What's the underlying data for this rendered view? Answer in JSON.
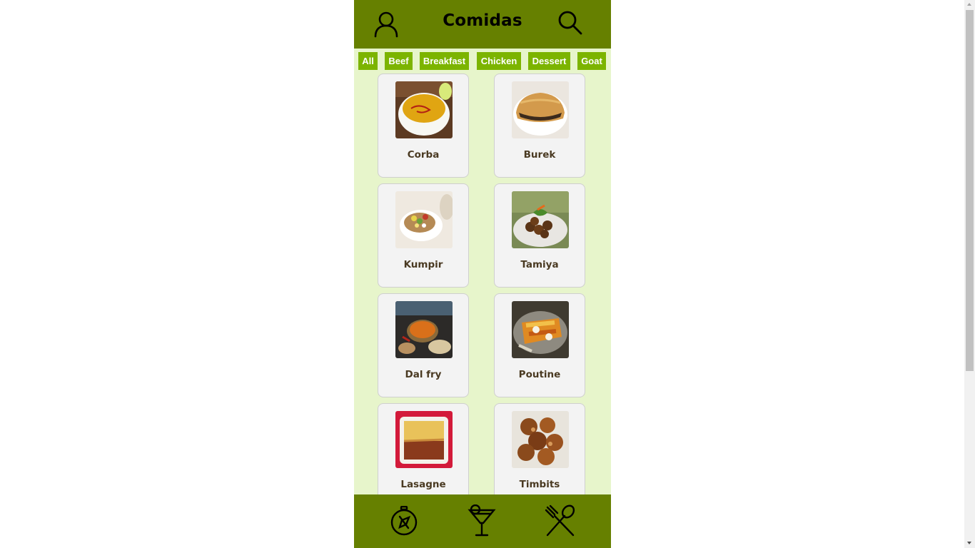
{
  "header": {
    "title": "Comidas",
    "profile_icon": "profile-icon",
    "search_icon": "search-icon"
  },
  "filters": [
    "All",
    "Beef",
    "Breakfast",
    "Chicken",
    "Dessert",
    "Goat"
  ],
  "recipes": [
    {
      "name": "Corba"
    },
    {
      "name": "Burek"
    },
    {
      "name": "Kumpir"
    },
    {
      "name": "Tamiya"
    },
    {
      "name": "Dal fry"
    },
    {
      "name": "Poutine"
    },
    {
      "name": "Lasagne"
    },
    {
      "name": "Timbits"
    }
  ],
  "footer": {
    "items": [
      {
        "icon": "explore-icon"
      },
      {
        "icon": "drink-icon"
      },
      {
        "icon": "meal-icon"
      }
    ]
  },
  "colors": {
    "header_bg": "#668000",
    "app_bg": "#e7f5cb",
    "chip_bg": "#7cb400",
    "card_bg": "#f3f3f3",
    "card_text": "#4a3a22"
  }
}
